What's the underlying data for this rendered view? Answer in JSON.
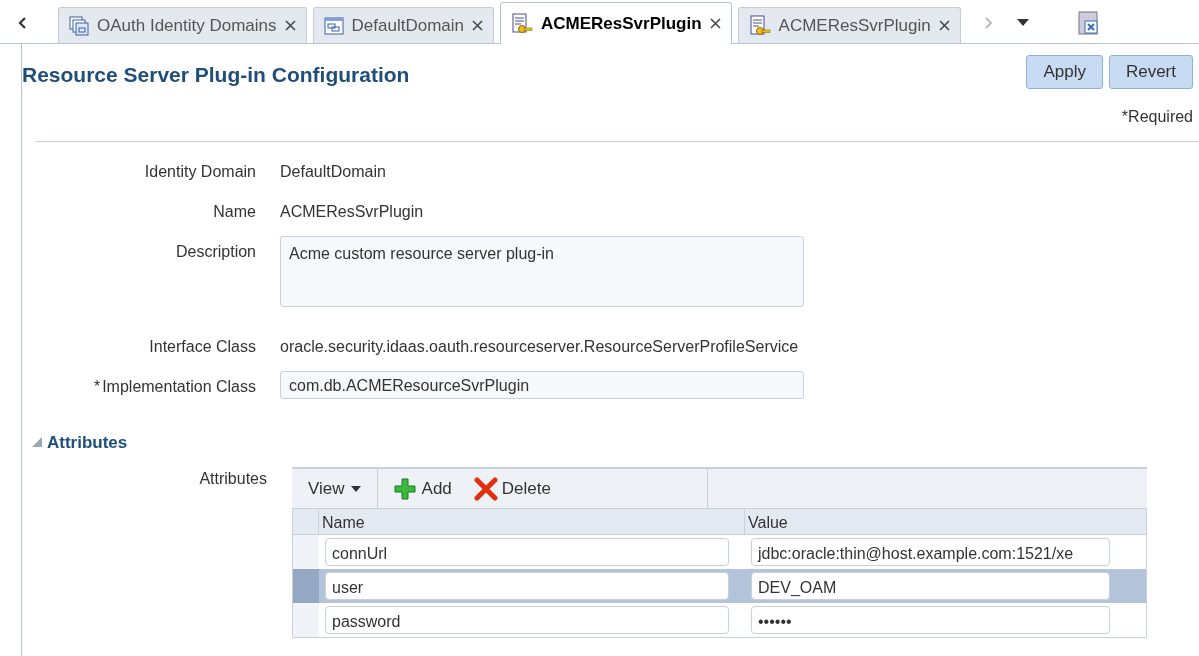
{
  "tabs": [
    {
      "label": "OAuth Identity Domains",
      "kind": "domains",
      "selected": false
    },
    {
      "label": "DefaultDomain",
      "kind": "domain",
      "selected": false
    },
    {
      "label": "ACMEResSvrPlugin",
      "kind": "plugin",
      "selected": true
    },
    {
      "label": "ACMEResSvrPlugin",
      "kind": "plugin",
      "selected": false
    }
  ],
  "page": {
    "title": "Resource Server Plug-in Configuration",
    "buttons": [
      "Apply",
      "Revert"
    ],
    "required_note": "*Required"
  },
  "form": [
    {
      "kind": "text",
      "label": "Identity Domain",
      "value": "DefaultDomain"
    },
    {
      "kind": "text",
      "label": "Name",
      "value": "ACMEResSvrPlugin"
    },
    {
      "kind": "textarea",
      "label": "Description",
      "value": "Acme custom resource server plug-in"
    },
    {
      "kind": "text",
      "label": "Interface Class",
      "value": "oracle.security.idaas.oauth.resourceserver.ResourceServerProfileService"
    },
    {
      "kind": "input",
      "label": "Implementation Class",
      "required_mark": "*",
      "value": "com.db.ACMEResourceSvrPlugin"
    }
  ],
  "attributes": {
    "section_title": "Attributes",
    "expanded": true,
    "label": "Attributes",
    "toolbar": {
      "view": "View",
      "add": "Add",
      "delete": "Delete"
    },
    "columns": [
      "Name",
      "Value"
    ],
    "rows": [
      {
        "name": "connUrl",
        "value": "jdbc:oracle:thin@host.example.com:1521/xe",
        "selected": false
      },
      {
        "name": "user",
        "value": "DEV_OAM",
        "selected": true
      },
      {
        "name": "password",
        "value": "••••••",
        "selected": false
      }
    ]
  }
}
